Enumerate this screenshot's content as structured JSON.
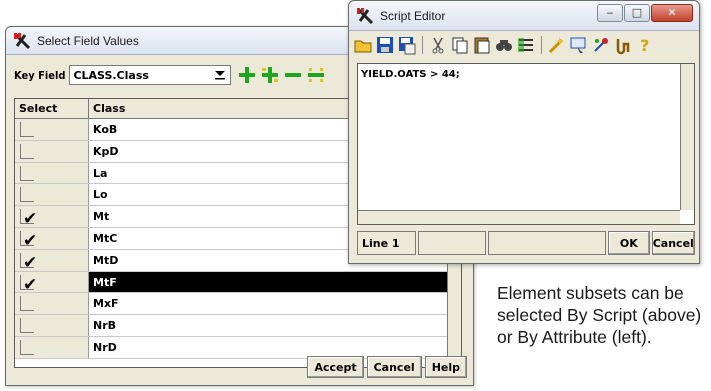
{
  "select_window": {
    "title": "Select Field Values",
    "key_field_label": "Key Field",
    "key_field_value": "CLASS.Class",
    "icons": [
      "add-icon",
      "add-all-icon",
      "remove-icon",
      "remove-all-icon"
    ],
    "columns": [
      "Select",
      "Class"
    ],
    "rows": [
      {
        "class": "KoB",
        "checked": false
      },
      {
        "class": "KpD",
        "checked": false
      },
      {
        "class": "La",
        "checked": false
      },
      {
        "class": "Lo",
        "checked": false
      },
      {
        "class": "Mt",
        "checked": true
      },
      {
        "class": "MtC",
        "checked": true
      },
      {
        "class": "MtD",
        "checked": true
      },
      {
        "class": "MtF",
        "checked": true,
        "selected": true
      },
      {
        "class": "MxF",
        "checked": false
      },
      {
        "class": "NrB",
        "checked": false
      },
      {
        "class": "NrD",
        "checked": false
      }
    ],
    "buttons": {
      "accept": "Accept",
      "cancel": "Cancel",
      "help": "Help"
    }
  },
  "script_window": {
    "title": "Script Editor",
    "script_text": "YIELD.OATS > 44;",
    "status_line": "Line 1",
    "buttons": {
      "ok": "OK",
      "cancel": "Cancel"
    }
  },
  "caption": "Element subsets can be selected By Script (above) or By Attribute (left).",
  "colors": {
    "accent_red": "#d21f1f",
    "window_bg": "#ece9d8",
    "selected_row": "#000000"
  }
}
